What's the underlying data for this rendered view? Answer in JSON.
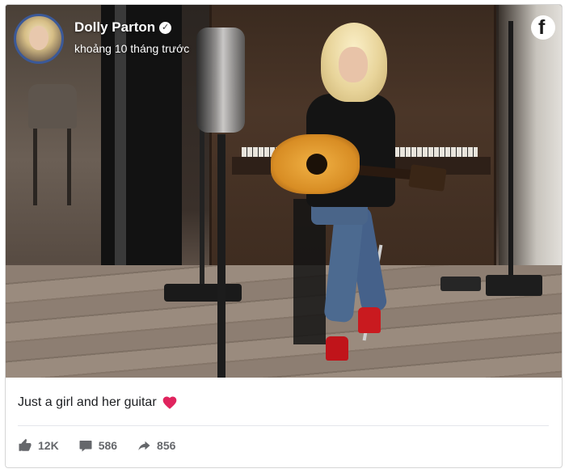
{
  "post": {
    "author": "Dolly Parton",
    "verified_icon": "verified-badge-icon",
    "timestamp": "khoảng 10 tháng trước",
    "brand_icon": "facebook-logo-icon",
    "caption": "Just a girl and her guitar",
    "caption_emoji": "red-heart-icon",
    "image": "photo-of-woman-playing-acoustic-guitar-by-piano"
  },
  "stats": {
    "likes": "12K",
    "comments": "586",
    "shares": "856"
  },
  "colors": {
    "text_primary": "#1c1e21",
    "text_secondary": "#65676b",
    "heart": "#e0245e",
    "avatar_border": "#3b5998"
  }
}
